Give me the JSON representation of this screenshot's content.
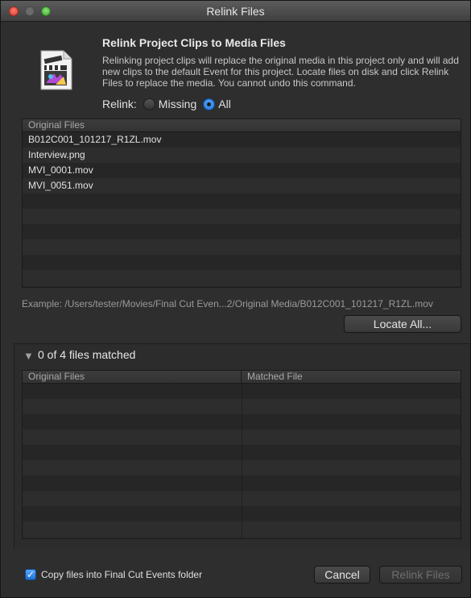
{
  "window": {
    "title": "Relink Files"
  },
  "header": {
    "heading": "Relink Project Clips to Media Files",
    "description": "Relinking project clips will replace the original media in this project only and will add new clips to the default Event for this project. Locate files on disk and click Relink Files to replace the media. You cannot undo this command."
  },
  "relink": {
    "label": "Relink:",
    "options": [
      {
        "label": "Missing",
        "selected": false
      },
      {
        "label": "All",
        "selected": true
      }
    ]
  },
  "original_table": {
    "header": "Original Files",
    "rows": [
      "B012C001_101217_R1ZL.mov",
      "Interview.png",
      "MVI_0001.mov",
      "MVI_0051.mov"
    ]
  },
  "example_path": "Example: /Users/tester/Movies/Final Cut Even...2/Original Media/B012C001_101217_R1ZL.mov",
  "locate_all_label": "Locate All...",
  "matched_section": {
    "summary": "0 of 4 files matched",
    "columns": [
      "Original Files",
      "Matched File"
    ]
  },
  "copy_checkbox": {
    "label": "Copy files into Final Cut Events folder",
    "checked": true
  },
  "buttons": {
    "cancel": "Cancel",
    "relink": "Relink Files"
  },
  "colors": {
    "accent": "#1f6fd1",
    "background": "#2e2e2e"
  }
}
